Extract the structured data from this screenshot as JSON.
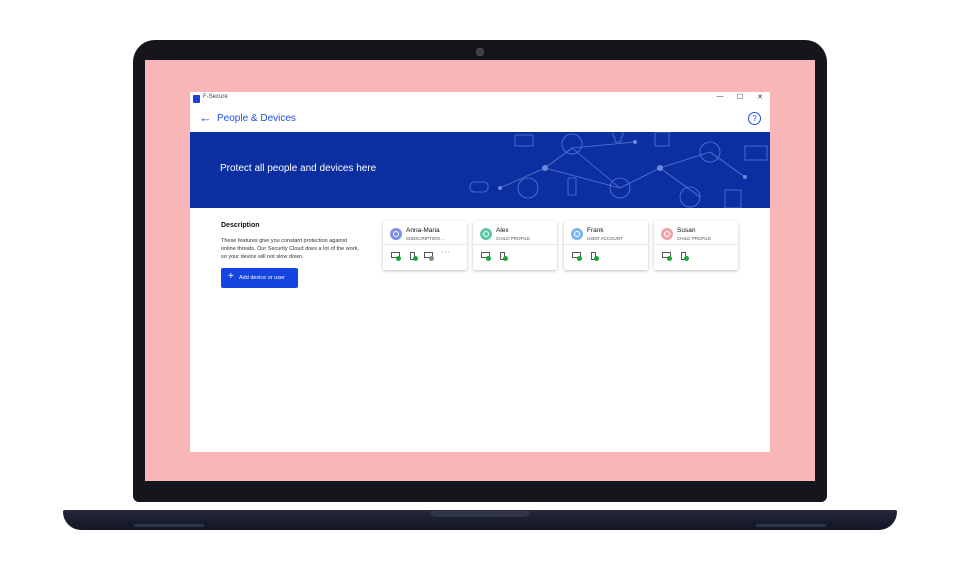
{
  "app": {
    "name": "F-Secure",
    "window_controls": {
      "minimize": "—",
      "maximize": "☐",
      "close": "✕"
    }
  },
  "nav": {
    "back": "←",
    "title": "People & Devices",
    "help": "?"
  },
  "banner": {
    "text": "Protect all people and devices here"
  },
  "description": {
    "title": "Description",
    "body": "These features give you constant protection against online threats. Our Security Cloud does a lot of the work, so your device will not slow down."
  },
  "actions": {
    "add_label": "Add device or user",
    "add_icon": "+"
  },
  "profiles": [
    {
      "name": "Anna-Maria",
      "role": "SUBSCRIPTION ...",
      "avatar_color": "#7f8fe8",
      "more": "···"
    },
    {
      "name": "Alex",
      "role": "CHILD PROFILE",
      "avatar_color": "#5fc8a0"
    },
    {
      "name": "Frank",
      "role": "USER ACCOUNT",
      "avatar_color": "#7cb6ee"
    },
    {
      "name": "Susan",
      "role": "CHILD PROFILE",
      "avatar_color": "#f0a0a8"
    }
  ],
  "colors": {
    "accent": "#1f4fe0",
    "banner": "#0b2fa1",
    "protected": "#1aa53a",
    "screen_bg": "#f8b6b8"
  }
}
